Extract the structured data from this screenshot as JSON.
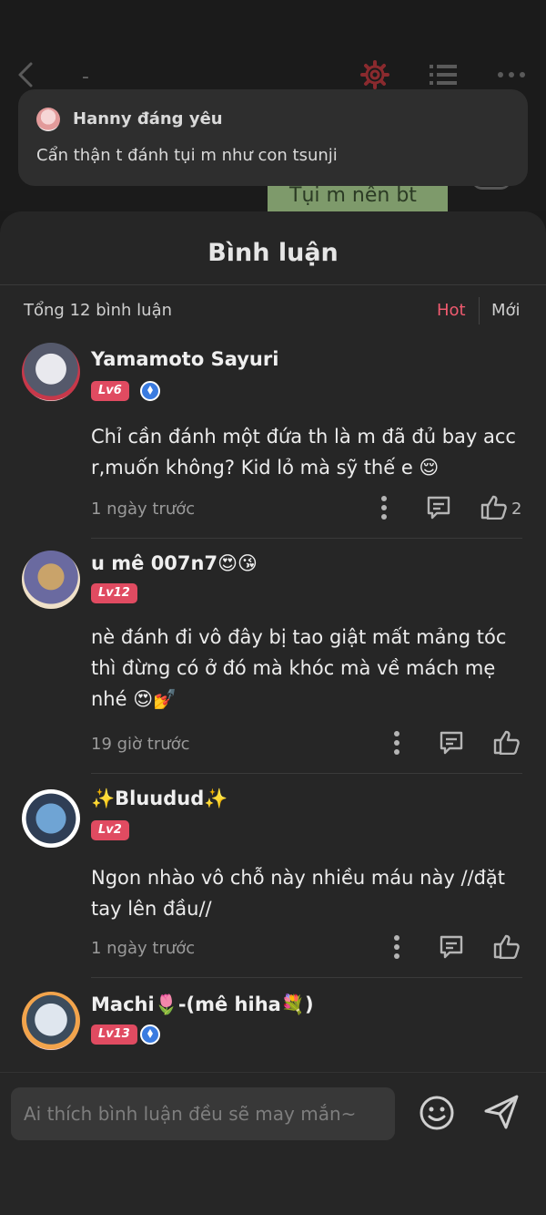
{
  "topbar": {
    "title_fragment": "-"
  },
  "background_message": "Tụi m nên bt",
  "notification": {
    "sender": "Hanny đáng yêu",
    "text": "Cẩn thận t đánh tụi m như con tsunji"
  },
  "sheet": {
    "title": "Bình luận",
    "total": "Tổng 12 bình luận",
    "sort_hot": "Hot",
    "sort_new": "Mới"
  },
  "comments": [
    {
      "name": "Yamamoto Sayuri",
      "level": "Lv6",
      "verified": true,
      "text": "Chỉ cần đánh một đứa th là m đã đủ bay acc r,muốn không? Kid lỏ mà sỹ thế e 😌",
      "time": "1 ngày trước",
      "likes": "2"
    },
    {
      "name": "u mê 007n7😍😘",
      "level": "Lv12",
      "verified": false,
      "text": "nè đánh đi vô đây bị tao giật mất mảng tóc thì đừng có ở đó mà khóc mà về mách mẹ nhé 😍💅",
      "time": "19 giờ trước",
      "likes": ""
    },
    {
      "name": "✨Bluudud✨",
      "level": "Lv2",
      "verified": false,
      "text": "Ngon nhào vô chỗ này nhiều máu này //đặt tay lên đầu//",
      "time": "1 ngày trước",
      "likes": ""
    },
    {
      "name": "Machi🌷-(mê hiha💐)",
      "level": "Lv13",
      "verified": true,
      "text": "",
      "time": "",
      "likes": ""
    }
  ],
  "input": {
    "placeholder": "Ai thích bình luận đều sẽ may mắn~"
  },
  "colors": {
    "accent": "#e04b61",
    "hot": "#ef5a6f",
    "sheet_bg": "#262626",
    "verify": "#3a7be0"
  }
}
